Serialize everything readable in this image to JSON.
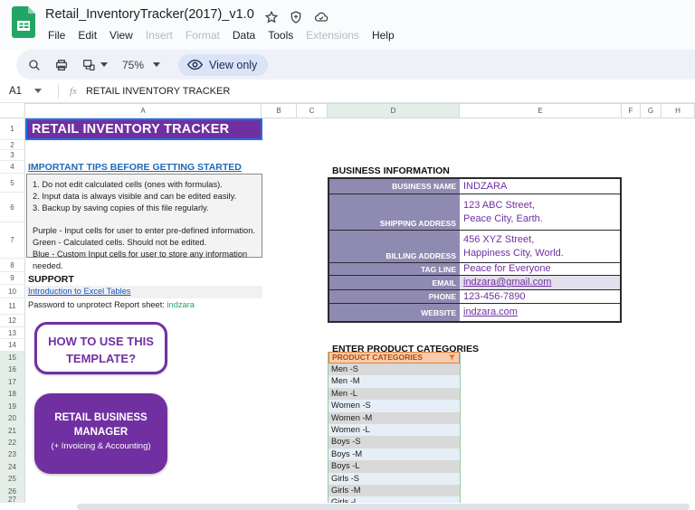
{
  "titlebar": {
    "doc_title": "Retail_InventoryTracker(2017)_v1.0"
  },
  "menubar": {
    "items": [
      {
        "label": "File",
        "enabled": true
      },
      {
        "label": "Edit",
        "enabled": true
      },
      {
        "label": "View",
        "enabled": true
      },
      {
        "label": "Insert",
        "enabled": false
      },
      {
        "label": "Format",
        "enabled": false
      },
      {
        "label": "Data",
        "enabled": true
      },
      {
        "label": "Tools",
        "enabled": true
      },
      {
        "label": "Extensions",
        "enabled": false
      },
      {
        "label": "Help",
        "enabled": true
      }
    ]
  },
  "toolbar": {
    "zoom_level": "75%",
    "view_only_label": "View only"
  },
  "formula_bar": {
    "cell_ref": "A1",
    "value": "RETAIL INVENTORY TRACKER"
  },
  "grid": {
    "columns": [
      "A",
      "B",
      "C",
      "D",
      "E",
      "F",
      "G",
      "H"
    ],
    "highlighted_column": "D",
    "row_count": 27,
    "filtered_rows_start": 15
  },
  "sheet": {
    "title_cell": "RETAIL INVENTORY TRACKER",
    "tips": {
      "heading": "IMPORTANT TIPS BEFORE GETTING STARTED",
      "lines": [
        "1. Do not edit calculated cells (ones with formulas).",
        "2. Input data is always visible and can be edited easily.",
        "3. Backup by saving copies of this file regularly.",
        "",
        "Purple - Input cells for user to enter pre-defined information.",
        "Green - Calculated cells. Should not be edited.",
        "Blue - Custom Input cells for user to store any information needed."
      ]
    },
    "support": {
      "heading": "SUPPORT",
      "link_text": "Introduction to Excel Tables",
      "password_label": "Password to unprotect Report sheet: ",
      "password_value": "indzara"
    },
    "howto_button": {
      "line1": "HOW TO USE THIS",
      "line2": "TEMPLATE?"
    },
    "rbm_button": {
      "line1": "RETAIL BUSINESS",
      "line2": "MANAGER",
      "line3": "(+ Invoicing & Accounting)"
    },
    "business_info": {
      "heading": "BUSINESS INFORMATION",
      "rows": [
        {
          "label": "BUSINESS NAME",
          "lines": [
            "INDZARA"
          ],
          "link": false,
          "highlight": false
        },
        {
          "label": "SHIPPING ADDRESS",
          "lines": [
            "123 ABC Street,",
            "Peace City, Earth."
          ],
          "link": false,
          "highlight": false
        },
        {
          "label": "BILLING ADDRESS",
          "lines": [
            "456 XYZ Street,",
            "Happiness City, World."
          ],
          "link": false,
          "highlight": false
        },
        {
          "label": "TAG LINE",
          "lines": [
            "Peace for Everyone"
          ],
          "link": false,
          "highlight": false
        },
        {
          "label": "EMAIL",
          "lines": [
            "indzara@gmail.com"
          ],
          "link": true,
          "highlight": true
        },
        {
          "label": "PHONE",
          "lines": [
            "123-456-7890"
          ],
          "link": false,
          "highlight": false
        },
        {
          "label": "WEBSITE",
          "lines": [
            "indzara.com"
          ],
          "link": true,
          "highlight": false
        }
      ]
    },
    "categories": {
      "heading": "ENTER PRODUCT CATEGORIES",
      "header": "PRODUCT CATEGORIES",
      "items": [
        "Men -S",
        "Men -M",
        "Men -L",
        "Women -S",
        "Women -M",
        "Women -L",
        "Boys -S",
        "Boys -M",
        "Boys -L",
        "Girls -S",
        "Girls -M",
        "Girls -L"
      ]
    }
  },
  "colors": {
    "accent_purple": "#7130A1",
    "value_purple": "#7030A0",
    "label_column_bg": "#8F8AB1",
    "link_blue": "#1155CC",
    "tips_heading_blue": "#2068B8",
    "password_green": "#21A366",
    "category_header_bg": "#F8CBAD",
    "category_header_text": "#B34A0A",
    "category_row_gray": "#D9D9D9",
    "category_row_blue": "#E6EFF7",
    "filter_green_border": "#98C9A2",
    "selection_blue": "#1A73E8",
    "view_only_chip_bg": "#DBE3F7"
  }
}
